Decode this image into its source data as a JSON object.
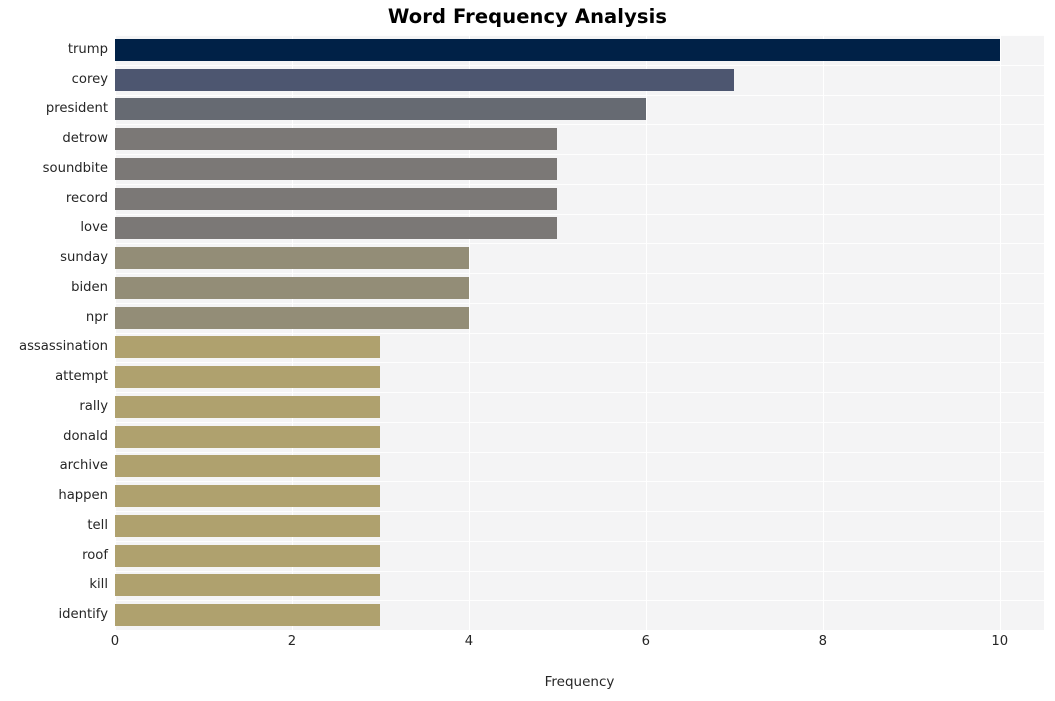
{
  "chart_data": {
    "type": "bar",
    "orientation": "horizontal",
    "title": "Word Frequency Analysis",
    "xlabel": "Frequency",
    "ylabel": "",
    "xlim": [
      0,
      10.5
    ],
    "xticks": [
      0,
      2,
      4,
      6,
      8,
      10
    ],
    "xtick_labels": [
      "0",
      "2",
      "4",
      "6",
      "8",
      "10"
    ],
    "grid": true,
    "legend": null,
    "categories": [
      "trump",
      "corey",
      "president",
      "detrow",
      "soundbite",
      "record",
      "love",
      "sunday",
      "biden",
      "npr",
      "assassination",
      "attempt",
      "rally",
      "donald",
      "archive",
      "happen",
      "tell",
      "roof",
      "kill",
      "identify"
    ],
    "values": [
      10,
      7,
      6,
      5,
      5,
      5,
      5,
      4,
      4,
      4,
      3,
      3,
      3,
      3,
      3,
      3,
      3,
      3,
      3,
      3
    ],
    "bar_colors": [
      "#002147",
      "#4D5670",
      "#666A72",
      "#7B7876",
      "#7B7876",
      "#7B7876",
      "#7B7876",
      "#938D77",
      "#938D77",
      "#938D77",
      "#AFA16E",
      "#AFA16E",
      "#AFA16E",
      "#AFA16E",
      "#AFA16E",
      "#AFA16E",
      "#AFA16E",
      "#AFA16E",
      "#AFA16E",
      "#AFA16E"
    ],
    "plot_background": "#F4F4F5",
    "grid_color": "#FFFFFF",
    "figure_background": "#FFFFFF",
    "text_color": "#262626",
    "title_color": "#000000"
  }
}
